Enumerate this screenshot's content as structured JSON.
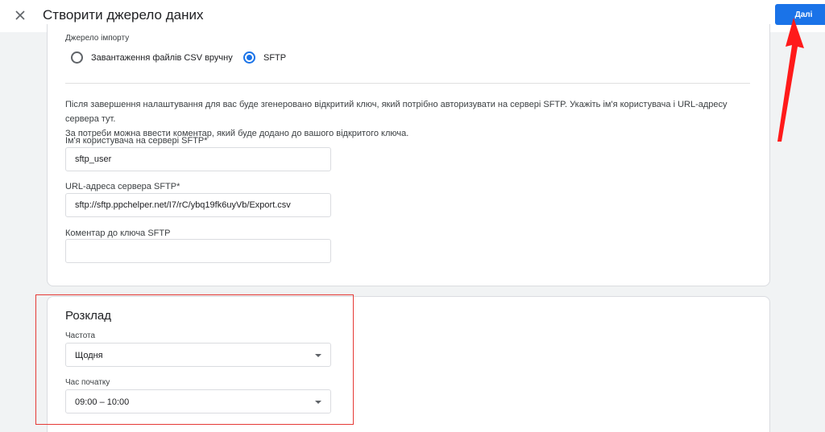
{
  "header": {
    "title": "Створити джерело даних",
    "next_label": "Далі"
  },
  "import_source": {
    "label": "Джерело імпорту",
    "options": [
      {
        "label": "Завантаження файлів CSV вручну",
        "selected": false
      },
      {
        "label": "SFTP",
        "selected": true
      }
    ]
  },
  "sftp": {
    "info_line1": "Після завершення налаштування для вас буде згенеровано відкритий ключ, який потрібно авторизувати на сервері SFTP. Укажіть ім'я користувача і URL-адресу сервера тут.",
    "info_line2": "За потреби можна ввести коментар, який буде додано до вашого відкритого ключа.",
    "username_label": "Ім'я користувача на сервері SFTP*",
    "username_value": "sftp_user",
    "url_label": "URL-адреса сервера SFTP*",
    "url_value": "sftp://sftp.ppchelper.net/I7/rC/ybq19fk6uyVb/Export.csv",
    "comment_label": "Коментар до ключа SFTP",
    "comment_value": ""
  },
  "schedule": {
    "title": "Розклад",
    "frequency_label": "Частота",
    "frequency_value": "Щодня",
    "start_time_label": "Час початку",
    "start_time_value": "09:00 – 10:00"
  },
  "colors": {
    "primary": "#1a73e8",
    "annotation_red": "#e53935",
    "arrow_red": "#ff1a1a"
  },
  "icons": {
    "close": "close-icon",
    "dropdown": "chevron-down-icon"
  }
}
